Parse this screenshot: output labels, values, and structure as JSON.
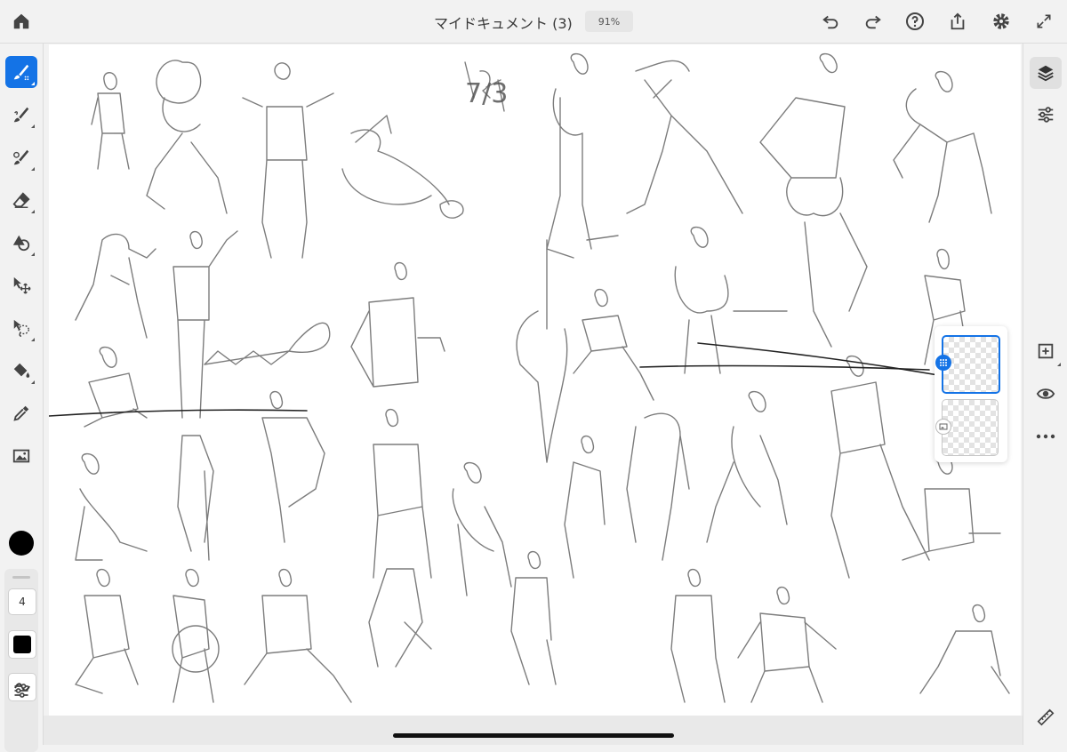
{
  "topbar": {
    "title": "マイドキュメント (3)",
    "zoom": "91%",
    "icons": [
      "home-icon",
      "undo-icon",
      "redo-icon",
      "help-icon",
      "share-icon",
      "gear-icon",
      "fullscreen-icon"
    ]
  },
  "left_toolbar": {
    "tools": [
      "pixel-brush-tool",
      "live-brush-tool",
      "vector-brush-tool",
      "eraser-tool",
      "shape-tool",
      "transform-tool",
      "lasso-tool",
      "fill-tool",
      "eyedropper-tool",
      "image-tool"
    ],
    "active_tool": "pixel-brush-tool",
    "color": "#000000",
    "brush_size": "4",
    "opacity_color": "#000000"
  },
  "right_toolbar": {
    "tools": [
      "layers-icon",
      "properties-icon",
      "add-layer-icon",
      "visibility-icon",
      "more-icon",
      "ruler-icon"
    ],
    "active_tool": "layers-icon"
  },
  "canvas": {
    "annotation": "7/3"
  },
  "layers": {
    "items": [
      {
        "type": "pixel",
        "selected": true
      },
      {
        "type": "image",
        "selected": false
      }
    ]
  },
  "colors": {
    "accent": "#1473e6",
    "toolbar_bg": "#f2f2f2",
    "canvas_bg": "#ffffff",
    "stroke": "#555555"
  }
}
